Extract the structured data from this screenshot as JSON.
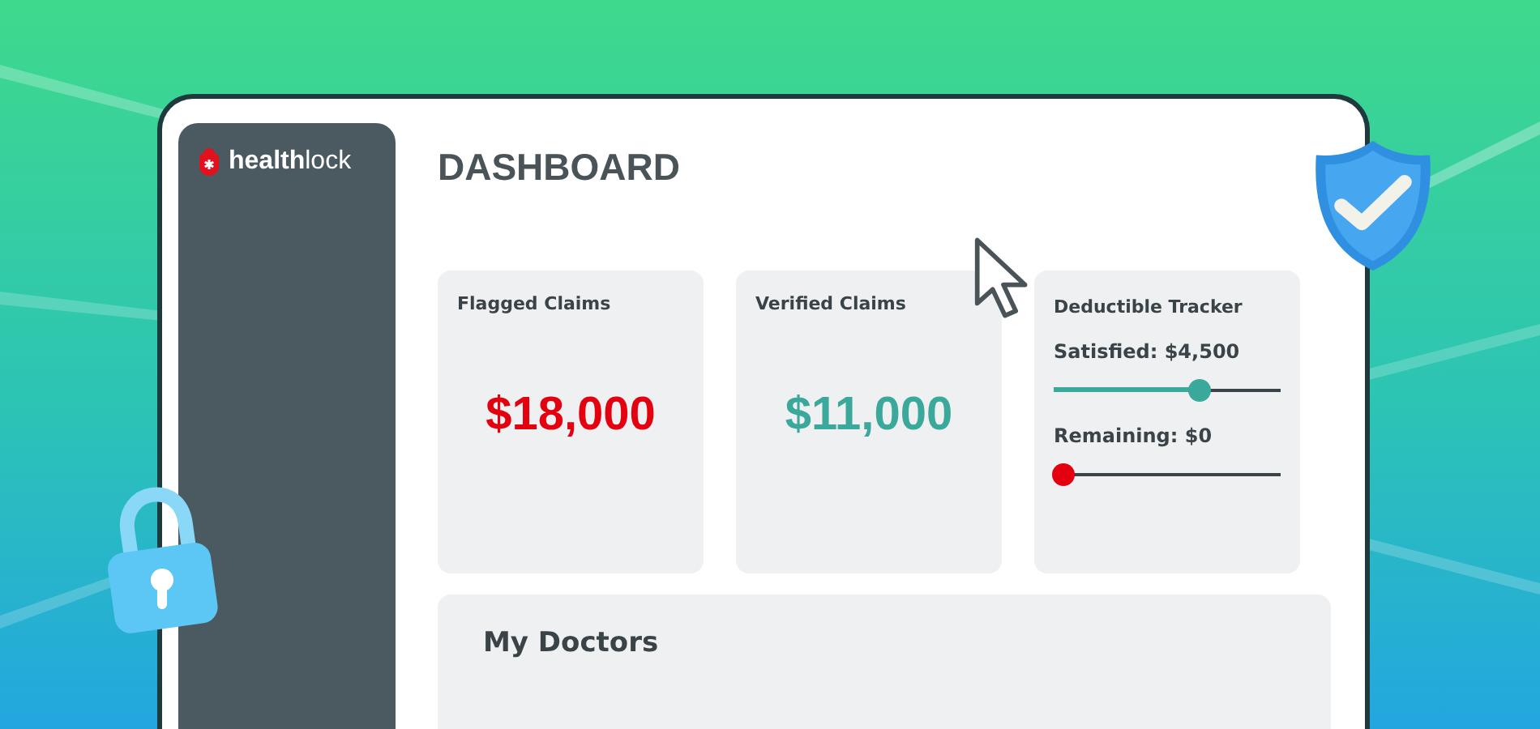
{
  "brand": {
    "name": "**health**lock"
  },
  "title": "DASHBOARD",
  "claims": [
    {
      "label": "Flagged Claims",
      "value": "$18,000",
      "color": "#e3000f"
    },
    {
      "label": "Verified Claims",
      "value": "$11,000",
      "color": "#3aa89b"
    }
  ],
  "tracker": {
    "title": "Deductible Tracker",
    "items": [
      {
        "label": "Satisfied: $4,500",
        "level": 0.64,
        "color": "#3aa89b"
      },
      {
        "label": "Remaining: $0",
        "level": 0.04,
        "color": "#e3000f"
      }
    ]
  },
  "doctors": {
    "title": "My Doctors"
  }
}
